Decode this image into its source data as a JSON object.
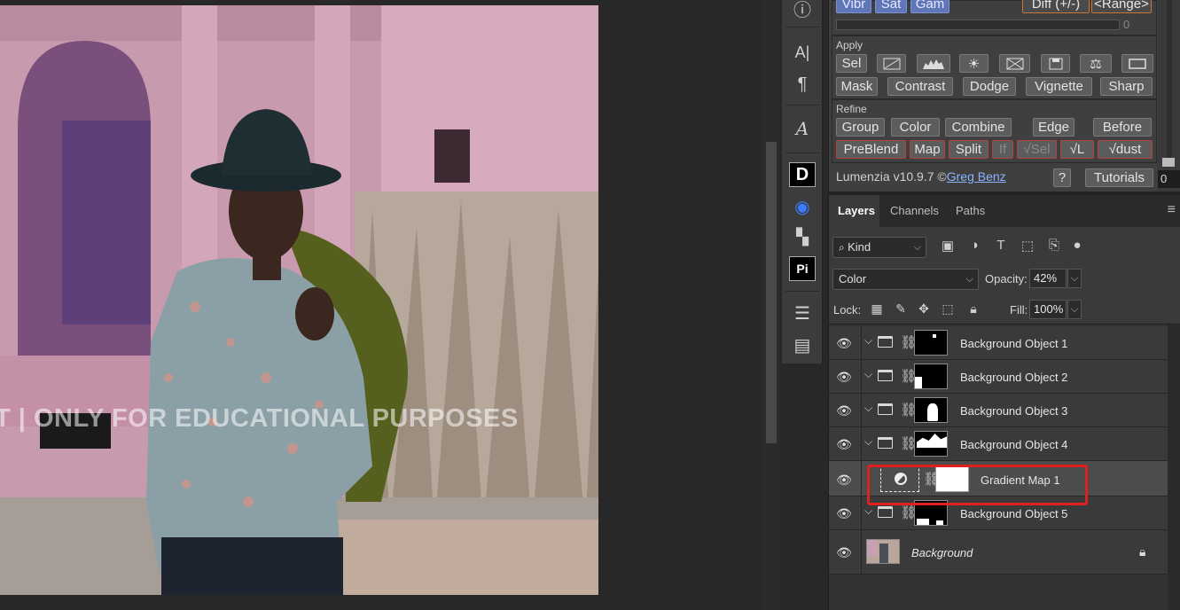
{
  "canvas": {
    "watermark": "T | ONLY FOR EDUCATIONAL PURPOSES"
  },
  "tools": [
    {
      "name": "info-icon",
      "glyph": "ⓘ"
    },
    {
      "name": "character-icon",
      "glyph": "A|"
    },
    {
      "name": "paragraph-icon",
      "glyph": "¶"
    },
    {
      "name": "glyph-icon",
      "glyph": "𝒜"
    },
    {
      "name": "plugin-d-icon",
      "glyph": "D"
    },
    {
      "name": "eye-plugin-icon",
      "glyph": "◉"
    },
    {
      "name": "plugin-b-icon",
      "glyph": "▚"
    },
    {
      "name": "pi-plugin-icon",
      "glyph": "Pi"
    },
    {
      "name": "adjustments-icon",
      "glyph": "☰"
    },
    {
      "name": "properties-icon",
      "glyph": "▤"
    }
  ],
  "lumenzia": {
    "top_row": {
      "vibr": "Vibr",
      "sat": "Sat",
      "gam": "Gam",
      "diff": "Diff (+/-)",
      "range": "<Range>",
      "slider_value": "0"
    },
    "apply_label": "Apply",
    "apply_icons": [
      "Sel",
      "",
      "",
      "",
      "",
      "",
      "",
      ""
    ],
    "apply_row2": [
      "Mask",
      "Contrast",
      "Dodge",
      "Vignette",
      "Sharp"
    ],
    "refine_label": "Refine",
    "refine_row1": [
      "Group",
      "Color",
      "Combine",
      "Edge",
      "Before"
    ],
    "refine_row2": [
      "PreBlend",
      "Map",
      "Split",
      "If",
      "√Sel",
      "√L",
      "√dust"
    ],
    "footer_text": "Lumenzia v10.9.7 ©",
    "footer_link": "Greg Benz",
    "help": "?",
    "tutorials": "Tutorials",
    "right_value": "0"
  },
  "layers_panel": {
    "tabs": [
      "Layers",
      "Channels",
      "Paths"
    ],
    "filter": {
      "kind": "Kind"
    },
    "blend_mode": "Color",
    "opacity_label": "Opacity:",
    "opacity_value": "42%",
    "lock_label": "Lock:",
    "fill_label": "Fill:",
    "fill_value": "100%",
    "layers": [
      {
        "name": "Background Object 1",
        "type": "group"
      },
      {
        "name": "Background Object 2",
        "type": "group"
      },
      {
        "name": "Background Object 3",
        "type": "group"
      },
      {
        "name": "Background Object 4",
        "type": "group"
      },
      {
        "name": "Gradient Map 1",
        "type": "adjustment",
        "selected": true
      },
      {
        "name": "Background Object 5",
        "type": "group"
      },
      {
        "name": "Background",
        "type": "background",
        "locked": true
      }
    ]
  },
  "colors": {
    "highlight": "#e02020",
    "link": "#8ab4ff",
    "selected_row": "#4c4c4c"
  }
}
